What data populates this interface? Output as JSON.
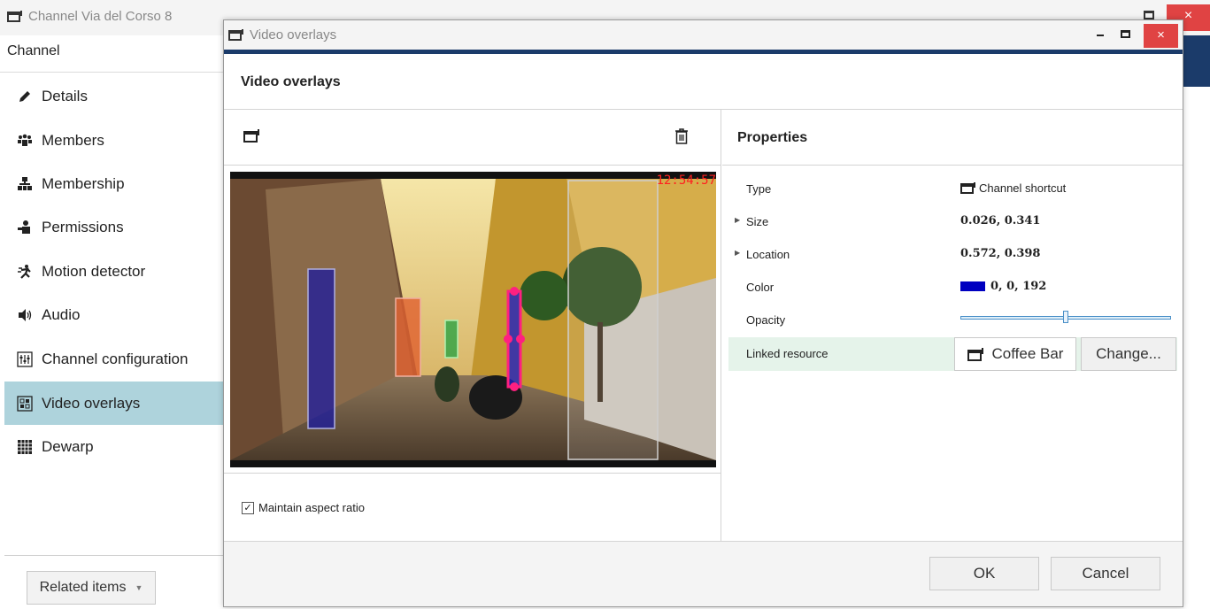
{
  "background_window": {
    "title": "Channel Via del Corso 8",
    "close_glyph": "×",
    "header": "Channel",
    "sidebar": [
      {
        "label": "Details",
        "icon": "pencil-icon"
      },
      {
        "label": "Members",
        "icon": "members-icon"
      },
      {
        "label": "Membership",
        "icon": "membership-icon"
      },
      {
        "label": "Permissions",
        "icon": "permissions-icon"
      },
      {
        "label": "Motion detector",
        "icon": "motion-icon"
      },
      {
        "label": "Audio",
        "icon": "speaker-icon"
      },
      {
        "label": "Channel configuration",
        "icon": "channel-config-icon"
      },
      {
        "label": "Video overlays",
        "icon": "video-overlays-icon",
        "active": true
      },
      {
        "label": "Dewarp",
        "icon": "dewarp-icon"
      }
    ],
    "related_items_label": "Related items",
    "accent": "#1b3b6a"
  },
  "dialog": {
    "title": "Video overlays",
    "close_glyph": "×",
    "heading": "Video overlays",
    "toolbar": {
      "add_icon": "channel-shortcut-icon",
      "delete_icon": "trash-icon"
    },
    "video": {
      "timestamp": "12:54:57"
    },
    "maintain_aspect_ratio": {
      "label": "Maintain aspect ratio",
      "checked": true,
      "glyph": "✓"
    },
    "properties": {
      "title": "Properties",
      "rows": {
        "type": {
          "label": "Type",
          "value": "Channel shortcut"
        },
        "size": {
          "label": "Size",
          "value": "0.026, 0.341"
        },
        "location": {
          "label": "Location",
          "value": "0.572, 0.398"
        },
        "color": {
          "label": "Color",
          "value": "0, 0, 192",
          "swatch": "#0000c0"
        },
        "opacity": {
          "label": "Opacity",
          "level": 0.5
        },
        "linked_resource": {
          "label": "Linked resource",
          "value": "Coffee Bar",
          "change_label": "Change..."
        }
      }
    },
    "ok_label": "OK",
    "cancel_label": "Cancel"
  }
}
